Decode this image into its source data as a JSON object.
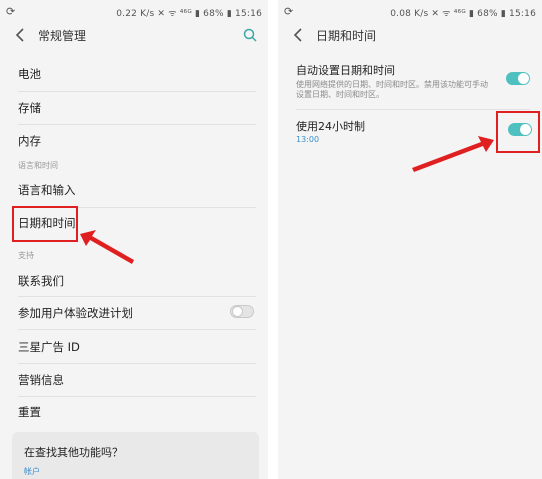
{
  "left": {
    "status": {
      "left_icon": "⟳",
      "right_text": "0.22 K/s ✕ ᯤ ⁴⁶ᴳ ▮ 68% ▮ 15:16"
    },
    "title": "常规管理",
    "items": [
      {
        "label": "电池"
      },
      {
        "label": "存储"
      },
      {
        "label": "内存"
      }
    ],
    "section1": "语言和时间",
    "items2": [
      {
        "label": "语言和输入"
      },
      {
        "label": "日期和时间"
      }
    ],
    "section2": "支持",
    "items3": [
      {
        "label": "联系我们"
      },
      {
        "label": "参加用户体验改进计划",
        "toggle": "off"
      },
      {
        "label": "三星广告 ID"
      },
      {
        "label": "营销信息"
      },
      {
        "label": "重置"
      }
    ],
    "card": {
      "title": "在查找其他功能吗？",
      "link": "帐户"
    }
  },
  "right": {
    "status": {
      "left_icon": "⟳",
      "right_text": "0.08 K/s ✕ ᯤ ⁴⁶ᴳ ▮ 68% ▮ 15:16"
    },
    "title": "日期和时间",
    "auto": {
      "label": "自动设置日期和时间",
      "desc_line1": "使用网络提供的日期、时间和时区。禁用该功能可手动",
      "desc_line2": "设置日期、时间和时区。",
      "toggle": "on"
    },
    "use24": {
      "label": "使用24小时制",
      "sub": "13:00",
      "toggle": "on"
    }
  },
  "colors": {
    "accent": "#4fc0c0",
    "highlight": "#e02020",
    "link": "#3a8fcf"
  }
}
